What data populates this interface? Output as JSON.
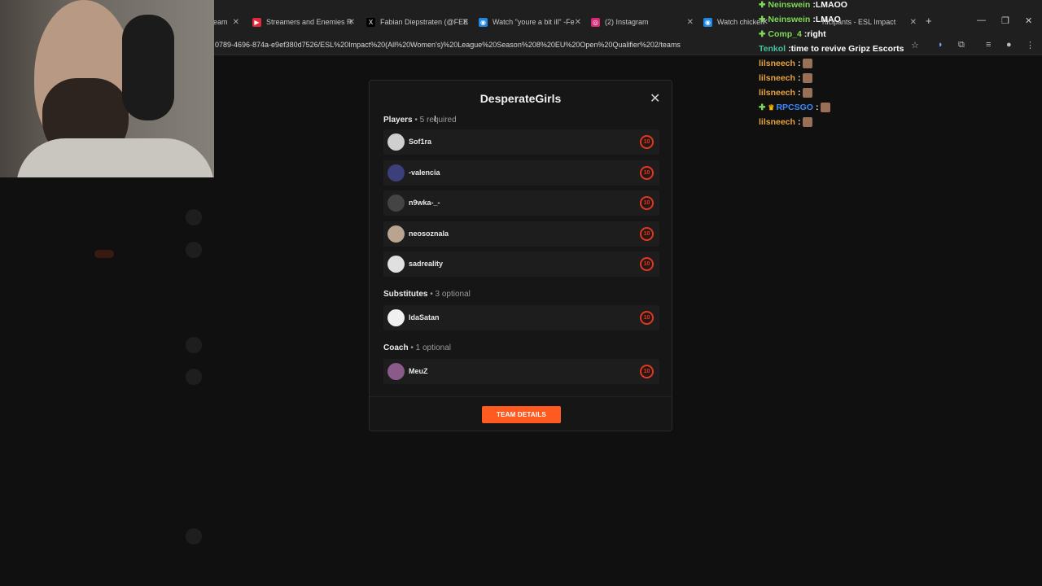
{
  "browser": {
    "tabs": [
      {
        "label": "eam",
        "icon": "",
        "icon_color": "#2a2a2a"
      },
      {
        "label": "Streamers and Enemies R",
        "icon": "▶",
        "icon_color": "#e5263c"
      },
      {
        "label": "Fabian Diepstraten (@FEE",
        "icon": "X",
        "icon_color": "#000000"
      },
      {
        "label": "Watch \"youre a bit ill\" -Fe",
        "icon": "◉",
        "icon_color": "#1e88e5"
      },
      {
        "label": "(2) Instagram",
        "icon": "◎",
        "icon_color": "#d62976"
      },
      {
        "label": "Watch chicken",
        "icon": "◉",
        "icon_color": "#1e88e5"
      },
      {
        "label": "rticipants - ESL Impact",
        "icon": "",
        "icon_color": "#2a2a2a"
      }
    ],
    "url": "0789-4696-874a-e9ef380d7526/ESL%20Impact%20(All%20Women's)%20League%20Season%208%20EU%20Open%20Qualifier%202/teams"
  },
  "chat": [
    {
      "user": "Neinswein",
      "user_color": "#7ed957",
      "badge": true,
      "message": "LMAOO",
      "emote": false
    },
    {
      "user": "Neinswein",
      "user_color": "#7ed957",
      "badge": true,
      "message": "LMAO",
      "emote": false
    },
    {
      "user": "Comp_4",
      "user_color": "#7ed957",
      "badge": true,
      "message": "right",
      "emote": false
    },
    {
      "user": "Tenkol",
      "user_color": "#46c3a0",
      "badge": false,
      "message": "time to revive Gripz Escorts",
      "emote": false
    },
    {
      "user": "lilsneech",
      "user_color": "#e8a33d",
      "badge": false,
      "message": "",
      "emote": true
    },
    {
      "user": "lilsneech",
      "user_color": "#e8a33d",
      "badge": false,
      "message": "",
      "emote": true
    },
    {
      "user": "lilsneech",
      "user_color": "#e8a33d",
      "badge": false,
      "message": "",
      "emote": true
    },
    {
      "user": "RPCSGO",
      "user_color": "#3d8bff",
      "badge": true,
      "crown": true,
      "message": "",
      "emote": true
    },
    {
      "user": "lilsneech",
      "user_color": "#e8a33d",
      "badge": false,
      "message": "",
      "emote": true
    }
  ],
  "modal": {
    "title": "DesperateGirls",
    "players_label": "Players",
    "players_note": " • 5 required",
    "players": [
      {
        "name": "Sof1ra",
        "level": "10",
        "avatar_color": "#cfcfcf"
      },
      {
        "name": "-valencia",
        "level": "10",
        "avatar_color": "#3b3f7a"
      },
      {
        "name": "n9wka-_-",
        "level": "10",
        "avatar_color": "#444444"
      },
      {
        "name": "neosoznala",
        "level": "10",
        "avatar_color": "#b9a48f"
      },
      {
        "name": "sadreality",
        "level": "10",
        "avatar_color": "#e0e0e0"
      }
    ],
    "subs_label": "Substitutes",
    "subs_note": " • 3 optional",
    "substitutes": [
      {
        "name": "IdaSatan",
        "level": "10",
        "avatar_color": "#f0f0f0"
      }
    ],
    "coach_label": "Coach",
    "coach_note": " • 1 optional",
    "coach": [
      {
        "name": "MeuZ",
        "level": "10",
        "avatar_color": "#8a5a8a"
      }
    ],
    "button_label": "TEAM DETAILS"
  }
}
